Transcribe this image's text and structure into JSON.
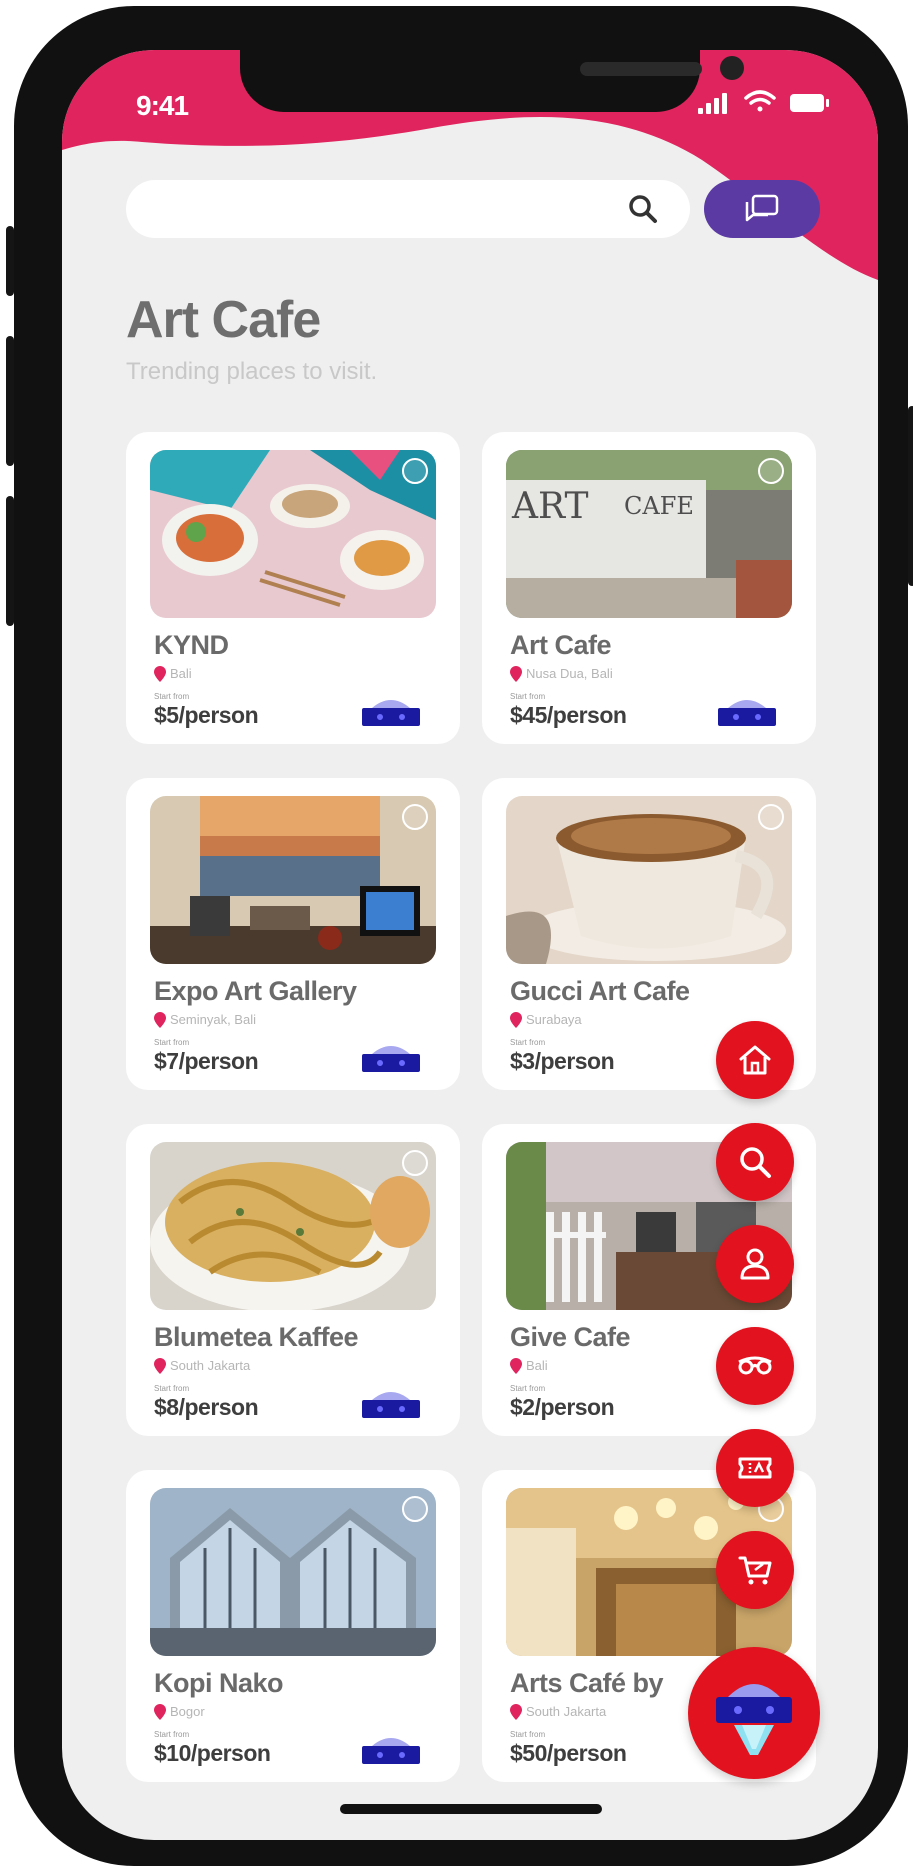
{
  "status_bar": {
    "time": "9:41"
  },
  "header": {
    "title": "Art Cafe",
    "subtitle": "Trending places to visit."
  },
  "search": {
    "placeholder": ""
  },
  "price_prefix": "Start from",
  "places": [
    {
      "name": "KYND",
      "location": "Bali",
      "price": "$5/person"
    },
    {
      "name": "Art Cafe",
      "location": "Nusa Dua, Bali",
      "price": "$45/person"
    },
    {
      "name": "Expo Art Gallery",
      "location": "Seminyak, Bali",
      "price": "$7/person"
    },
    {
      "name": "Gucci Art Cafe",
      "location": "Surabaya",
      "price": "$3/person"
    },
    {
      "name": "Blumetea Kaffee",
      "location": "South Jakarta",
      "price": "$8/person"
    },
    {
      "name": "Give Cafe",
      "location": "Bali",
      "price": "$2/person"
    },
    {
      "name": "Kopi Nako",
      "location": "Bogor",
      "price": "$10/person"
    },
    {
      "name": "Arts Café by",
      "location": "South Jakarta",
      "price": "$50/person"
    }
  ],
  "colors": {
    "accent_pink": "#e0245e",
    "chat_purple": "#5b3aa4",
    "fab_red": "#e2121e",
    "vr_blue": "#1a1aa0",
    "background": "#efefef"
  },
  "icons": {
    "fab_menu": [
      "home-icon",
      "search-icon",
      "profile-icon",
      "vr-glasses-icon",
      "ticket-icon",
      "cart-icon"
    ],
    "fab_main": "vr-headset-icon"
  }
}
